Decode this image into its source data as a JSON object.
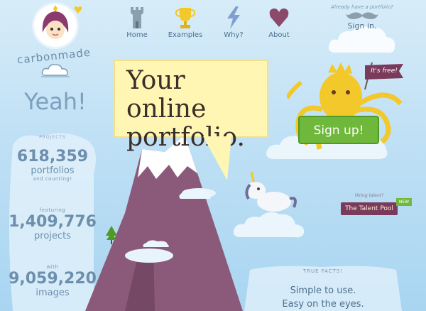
{
  "nav": {
    "items": [
      {
        "label": "Home"
      },
      {
        "label": "Examples"
      },
      {
        "label": "Why?"
      },
      {
        "label": "About"
      }
    ]
  },
  "auth": {
    "prompt": "Already have a portfolio?",
    "signin": "Sign in."
  },
  "brand": {
    "name": "carbonmade",
    "yeah": "Yeah!"
  },
  "stats": {
    "portfolios_count": "618,359",
    "portfolios_label": "portfolios",
    "portfolios_sub": "and counting!",
    "projects_pre": "featuring",
    "projects_count": "1,409,776",
    "projects_label": "projects",
    "images_pre": "with",
    "images_count": "9,059,220",
    "images_label": "images",
    "projects_tag": "PROJECTS"
  },
  "hero": {
    "headline_line1": "Your online",
    "headline_line2": "portfolio.",
    "free_flag": "It's free!",
    "signup": "Sign up!"
  },
  "talent": {
    "above": "Hiring talent?",
    "button": "The Talent Pool",
    "tag": "NEW"
  },
  "facts": {
    "heading": "TRUE FACTS!",
    "line1": "Simple to use.",
    "line2": "Easy on the eyes."
  },
  "colors": {
    "sky": "#bfe0f5",
    "mountain": "#8b5a7a",
    "signup_green": "#6fb83b",
    "bubble": "#fff6b3",
    "octopus": "#f2c82a"
  }
}
